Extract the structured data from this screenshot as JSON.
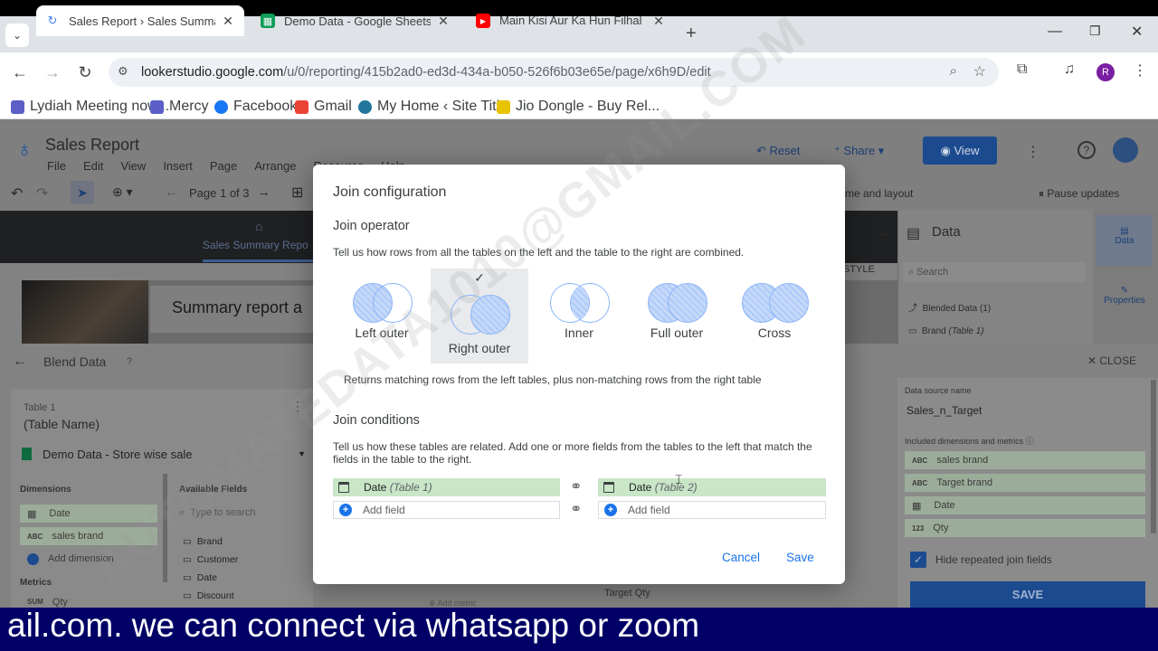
{
  "browser": {
    "tabs": [
      {
        "label": "Sales Report › Sales Summary R",
        "icon": "looker-studio-icon"
      },
      {
        "label": "Demo Data - Google Sheets",
        "icon": "sheets-icon"
      },
      {
        "label": "Main Kisi Aur Ka Hun Filhal 💔",
        "icon": "youtube-icon"
      }
    ],
    "url_host": "lookerstudio.google.com",
    "url_path": "/u/0/reporting/415b2ad0-ed3d-434a-b050-526f6b03e65e/page/x6h9D/edit",
    "profile_initial": "R",
    "bookmarks": [
      "Lydiah Meeting now...",
      "Mercy",
      "Facebook",
      "Gmail",
      "My Home ‹ Site Titl...",
      "Jio Dongle - Buy Rel..."
    ]
  },
  "app": {
    "title": "Sales Report",
    "menu": [
      "File",
      "Edit",
      "View",
      "Insert",
      "Page",
      "Arrange",
      "Resource",
      "Help"
    ],
    "reset_label": "Reset",
    "share_label": "Share",
    "view_label": "View",
    "page_indicator": "Page 1 of 3",
    "theme_label": "me and layout",
    "pause_label": "Pause updates",
    "page_tab": "Sales Summary Repo",
    "banner_text": "Summary report a",
    "data_panel_title": "Data",
    "data_search_placeholder": "Search",
    "data_item_1": "Blended Data (1)",
    "data_item_2": "Brand",
    "data_item_2_suffix": "(Table 1)",
    "style_label": "STYLE",
    "rail_data": "Data",
    "rail_properties": "Properties"
  },
  "blend": {
    "title": "Blend Data",
    "close_label": "CLOSE",
    "table1_title": "Table 1",
    "table_name": "(Table Name)",
    "data_source": "Demo Data - Store wise sale",
    "dimensions_label": "Dimensions",
    "dim_date": "Date",
    "dim_sales_brand": "sales brand",
    "add_dimension": "Add dimension",
    "metrics_label": "Metrics",
    "metric_qty": "Qty",
    "available_fields": "Available Fields",
    "type_to_search": "Type to search",
    "fields": [
      "Brand",
      "Customer",
      "Date",
      "Discount"
    ],
    "target_qty": "Target Qty",
    "add_metric": "Add metric",
    "ds_name_label": "Data source name",
    "ds_name": "Sales_n_Target",
    "included_label": "Included dimensions and metrics",
    "included": [
      {
        "type": "ABC",
        "name": "sales brand"
      },
      {
        "type": "ABC",
        "name": "Target brand"
      },
      {
        "type": "cal",
        "name": "Date"
      },
      {
        "type": "123",
        "name": "Qty"
      }
    ],
    "hide_repeated": "Hide repeated join fields",
    "save_label": "SAVE"
  },
  "modal": {
    "title": "Join configuration",
    "operator_heading": "Join operator",
    "operator_desc": "Tell us how rows from all the tables on the left and the table to the right are combined.",
    "operators": [
      "Left outer",
      "Right outer",
      "Inner",
      "Full outer",
      "Cross"
    ],
    "selected_operator": "Right outer",
    "selected_desc": "Returns matching rows from the left tables, plus non-matching rows from the right table",
    "conditions_heading": "Join conditions",
    "conditions_desc": "Tell us how these tables are related. Add one or more fields from the tables to the left that match the fields in the table to the right.",
    "left_field": "Date",
    "left_table": "(Table 1)",
    "right_field": "Date",
    "right_table": "(Table 2)",
    "add_field": "Add field",
    "cancel_label": "Cancel",
    "save_label": "Save"
  },
  "watermark": "AUTOMATEDATA1010@GMAIL.COM",
  "caption": "ail.com. we can connect via whatsapp or zoom"
}
